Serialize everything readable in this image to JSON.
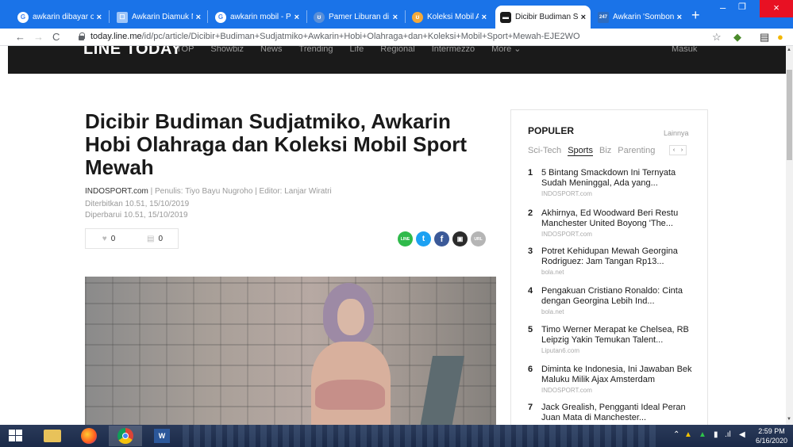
{
  "browser": {
    "tabs": [
      {
        "title": "awkarin dibayar ole",
        "favicon": "google-g",
        "active": false
      },
      {
        "title": "Awkarin Diamuk Ne",
        "favicon": "news-icon",
        "active": false
      },
      {
        "title": "awkarin mobil - Pe",
        "favicon": "google-g",
        "active": false
      },
      {
        "title": "Pamer Liburan di E",
        "favicon": "site-icon",
        "active": false
      },
      {
        "title": "Koleksi Mobil Awka",
        "favicon": "site-icon",
        "active": false
      },
      {
        "title": "Dicibir Budiman Su",
        "favicon": "line-icon",
        "active": true
      },
      {
        "title": "Awkarin 'Sombong",
        "favicon": "news-icon",
        "active": false
      }
    ],
    "tab_favicon_letters": [
      "G",
      "☐",
      "G",
      "ʊ",
      "ʊ",
      "▬",
      "247"
    ],
    "url_host": "today.line.me",
    "url_path": "/id/pc/article/Dicibir+Budiman+Sudjatmiko+Awkarin+Hobi+Olahraga+dan+Koleksi+Mobil+Sport+Mewah-EJE2WO",
    "accent_color": "#1a73e8"
  },
  "site": {
    "logo": "LINE TODAY",
    "nav": [
      "TOP",
      "Showbiz",
      "News",
      "Trending",
      "Life",
      "Regional",
      "Intermezzo",
      "More ⌄"
    ],
    "login": "Masuk"
  },
  "article": {
    "title": "Dicibir Budiman Sudjatmiko, Awkarin Hobi Olahraga dan Koleksi Mobil Sport Mewah",
    "source": "INDOSPORT.com",
    "credits": "|  Penulis: Tiyo Bayu Nugroho | Editor: Lanjar Wiratri",
    "published": "Diterbitkan 10.51, 15/10/2019",
    "updated": "Diperbarui 10.51, 15/10/2019",
    "likes": "0",
    "comments": "0",
    "share_buttons": [
      "LINE",
      "t",
      "f",
      "▣",
      "URL"
    ]
  },
  "sidebar": {
    "title": "POPULER",
    "more": "Lainnya",
    "tabs": [
      "Sci-Tech",
      "Sports",
      "Biz",
      "Parenting"
    ],
    "active_tab": "Sports",
    "items": [
      {
        "num": "1",
        "title": "5 Bintang Smackdown Ini Ternyata Sudah Meninggal, Ada yang...",
        "source": "INDOSPORT.com"
      },
      {
        "num": "2",
        "title": "Akhirnya, Ed Woodward Beri Restu Manchester United Boyong 'The...",
        "source": "INDOSPORT.com"
      },
      {
        "num": "3",
        "title": "Potret Kehidupan Mewah Georgina Rodriguez: Jam Tangan Rp13...",
        "source": "bola.net"
      },
      {
        "num": "4",
        "title": "Pengakuan Cristiano Ronaldo: Cinta dengan Georgina Lebih Ind...",
        "source": "bola.net"
      },
      {
        "num": "5",
        "title": "Timo Werner Merapat ke Chelsea, RB Leipzig Yakin Temukan Talent...",
        "source": "Liputan6.com"
      },
      {
        "num": "6",
        "title": "Diminta ke Indonesia, Ini Jawaban Bek Maluku Milik Ajax Amsterdam",
        "source": "INDOSPORT.com"
      },
      {
        "num": "7",
        "title": "Jack Grealish, Pengganti Ideal Peran Juan Mata di Manchester...",
        "source": ""
      }
    ]
  },
  "taskbar": {
    "time": "2:59 PM",
    "date": "6/16/2020"
  }
}
